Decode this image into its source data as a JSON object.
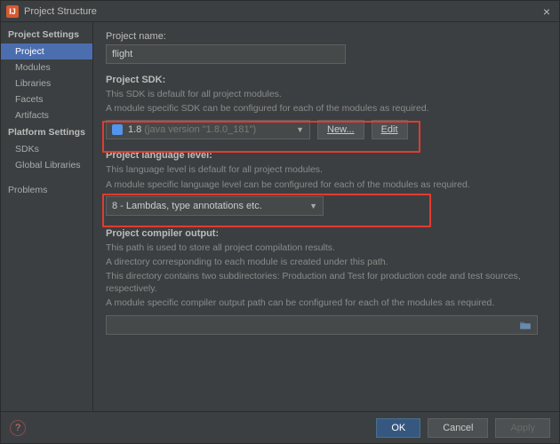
{
  "window": {
    "title": "Project Structure"
  },
  "sidebar": {
    "section1": "Project Settings",
    "items1": [
      "Project",
      "Modules",
      "Libraries",
      "Facets",
      "Artifacts"
    ],
    "section2": "Platform Settings",
    "items2": [
      "SDKs",
      "Global Libraries"
    ],
    "problems": "Problems"
  },
  "content": {
    "projectNameLabel": "Project name:",
    "projectNameValue": "flight",
    "sdkLabel": "Project SDK:",
    "sdkDesc1": "This SDK is default for all project modules.",
    "sdkDesc2": "A module specific SDK can be configured for each of the modules as required.",
    "sdkValuePrefix": "1.8",
    "sdkValueDim": "(java version \"1.8.0_181\")",
    "newBtn": "New...",
    "editBtn": "Edit",
    "langLabel": "Project language level:",
    "langDesc1": "This language level is default for all project modules.",
    "langDesc2": "A module specific language level can be configured for each of the modules as required.",
    "langValue": "8 - Lambdas, type annotations etc.",
    "compilerLabel": "Project compiler output:",
    "compilerDesc1": "This path is used to store all project compilation results.",
    "compilerDesc2": "A directory corresponding to each module is created under this path.",
    "compilerDesc3": "This directory contains two subdirectories: Production and Test for production code and test sources, respectively.",
    "compilerDesc4": "A module specific compiler output path can be configured for each of the modules as required."
  },
  "footer": {
    "ok": "OK",
    "cancel": "Cancel",
    "apply": "Apply"
  }
}
